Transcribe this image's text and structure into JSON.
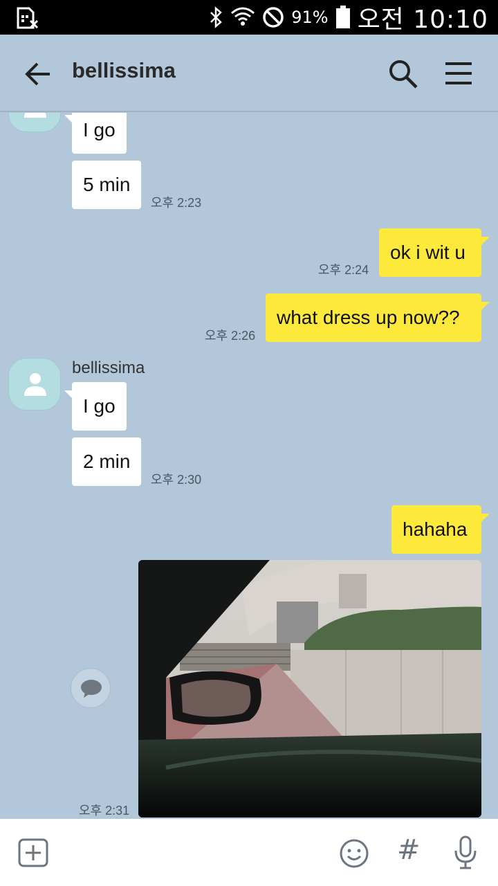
{
  "status_bar": {
    "battery_percent": "91%",
    "time": "오전 10:10",
    "icons": [
      "sim-blocked-icon",
      "bluetooth-icon",
      "wifi-icon",
      "do-not-disturb-icon",
      "battery-icon"
    ]
  },
  "header": {
    "title": "bellissima",
    "icons": [
      "back-arrow-icon",
      "search-icon",
      "hamburger-menu-icon"
    ]
  },
  "messages": [
    {
      "side": "in",
      "text": "I go"
    },
    {
      "side": "in",
      "text": "5 min",
      "time": "오후 2:23"
    },
    {
      "side": "out",
      "text": "ok i wit u",
      "time": "오후 2:24"
    },
    {
      "side": "out",
      "text": "what dress up now??",
      "time": "오후 2:26"
    },
    {
      "side": "in",
      "sender": "bellissima",
      "text": "I go"
    },
    {
      "side": "in",
      "text": "2 min",
      "time": "오후 2:30"
    },
    {
      "side": "out",
      "text": "hahaha"
    },
    {
      "side": "out",
      "type": "photo",
      "time": "오후 2:31"
    }
  ],
  "bottom_bar": {
    "icons": [
      "plus-icon",
      "emoji-icon",
      "hashtag-icon",
      "microphone-icon"
    ],
    "hash_glyph": "#"
  },
  "colors": {
    "chat_background": "#b2c7da",
    "incoming_bubble": "#ffffff",
    "outgoing_bubble": "#fde83c"
  }
}
